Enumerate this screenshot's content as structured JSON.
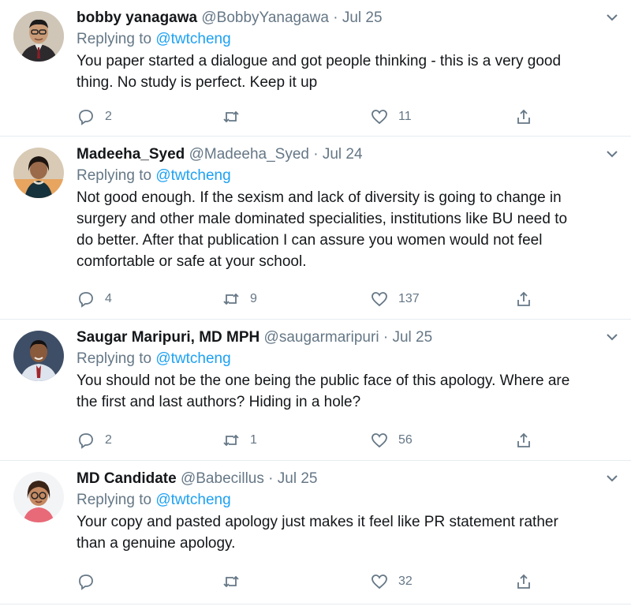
{
  "tweets": [
    {
      "name": "bobby yanagawa",
      "handle": "@BobbyYanagawa",
      "sep": "·",
      "date": "Jul 25",
      "replying_prefix": "Replying to",
      "replying_to": "@twtcheng",
      "lines": [
        "You paper started a dialogue and got people thinking - this is a very good",
        "thing. No study is perfect. Keep it up"
      ],
      "replies": "2",
      "retweets": "",
      "likes": "11",
      "avatar_bg": "#c9c2b6"
    },
    {
      "name": "Madeeha_Syed",
      "handle": "@Madeeha_Syed",
      "sep": "·",
      "date": "Jul 24",
      "replying_prefix": "Replying to",
      "replying_to": "@twtcheng",
      "lines": [
        "Not good enough. If the sexism and lack of diversity is going to change in",
        "surgery and other male dominated specialities, institutions like BU need to",
        "do better. After that publication I can assure you women would not feel",
        "comfortable or safe at your school."
      ],
      "replies": "4",
      "retweets": "9",
      "likes": "137",
      "avatar_bg": "#d9c7ae"
    },
    {
      "name": "Saugar Maripuri, MD MPH",
      "handle": "@saugarmaripuri",
      "sep": "·",
      "date": "Jul 25",
      "replying_prefix": "Replying to",
      "replying_to": "@twtcheng",
      "lines": [
        "You should not be the one being the public face of this apology. Where are",
        "the first and last authors? Hiding in a hole?"
      ],
      "replies": "2",
      "retweets": "1",
      "likes": "56",
      "avatar_bg": "#4a5a72"
    },
    {
      "name": "MD Candidate",
      "handle": "@Babecillus",
      "sep": "·",
      "date": "Jul 25",
      "replying_prefix": "Replying to",
      "replying_to": "@twtcheng",
      "lines": [
        "Your copy and pasted apology just makes it feel like PR statement rather",
        "than a genuine apology."
      ],
      "replies": "",
      "retweets": "",
      "likes": "32",
      "avatar_bg": "#f3f4f6"
    }
  ],
  "colors": {
    "link": "#1da1f2",
    "muted": "#657786",
    "text": "#14171a",
    "divider": "#e6ecf0"
  },
  "icons": [
    "reply-icon",
    "retweet-icon",
    "like-icon",
    "share-icon",
    "chevron-down-icon"
  ]
}
